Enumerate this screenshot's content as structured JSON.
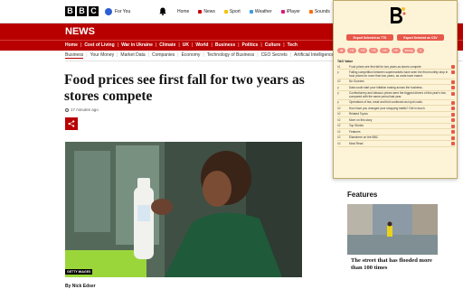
{
  "topbar": {
    "logo_letters": [
      "B",
      "B",
      "C"
    ],
    "signin_label": "For You",
    "nav": [
      {
        "label": "Home",
        "icon": ""
      },
      {
        "label": "News",
        "icon": "news-icon"
      },
      {
        "label": "Sport",
        "icon": "sport-icon"
      },
      {
        "label": "Weather",
        "icon": "weather-icon"
      },
      {
        "label": "iPlayer",
        "icon": "iplayer-icon"
      },
      {
        "label": "Sounds",
        "icon": "sounds-icon"
      }
    ]
  },
  "news_bar": {
    "title": "NEWS",
    "nav": [
      "Home",
      "Cost of Living",
      "War in Ukraine",
      "Climate",
      "UK",
      "World",
      "Business",
      "Politics",
      "Culture",
      "Tech"
    ]
  },
  "sub_nav": [
    "Business",
    "Your Money",
    "Market Data",
    "Companies",
    "Economy",
    "Technology of Business",
    "CEO Secrets",
    "Artificial Intelligence"
  ],
  "article": {
    "headline": "Food prices see first fall for two years as stores compete",
    "timestamp": "17 minutes ago",
    "photo_caption": "GETTY IMAGES",
    "byline": "By Nick Edser"
  },
  "features": {
    "title": "Features",
    "item_text": "The street that has flooded more than 100 times"
  },
  "popup": {
    "btn_selected": "Export Selected as TTS",
    "btn_csv": "Export Selected as CSV",
    "tags": [
      "all",
      "H1",
      "H2",
      "H3",
      "H4",
      "H5",
      "strong",
      "li"
    ],
    "list_head": "TAG   Value",
    "rows": [
      {
        "tag": "h1",
        "text": "Food prices see first fall for two years as stores compete"
      },
      {
        "tag": "p",
        "text": "Falling competition between supermarkets have seen the first monthly drop in food prices for more than two years, as costs have eased."
      },
      {
        "tag": "h2",
        "text": "No Sources"
      },
      {
        "tag": "p",
        "text": "Data could start your inflation easing across the business."
      },
      {
        "tag": "p",
        "text": "Confectionery and tobacco prices were the biggest drivers of this year's rise, compared with the same period last year."
      },
      {
        "tag": "p",
        "text": "Operations of tea, meat and fruit continued as input costs."
      },
      {
        "tag": "h2",
        "text": "How have you changed your shopping habits? Get in touch."
      },
      {
        "tag": "h2",
        "text": "Related Topics"
      },
      {
        "tag": "h2",
        "text": "More on this story"
      },
      {
        "tag": "h2",
        "text": "Top Stories"
      },
      {
        "tag": "h2",
        "text": "Features"
      },
      {
        "tag": "h2",
        "text": "Elsewhere on the BBC"
      },
      {
        "tag": "h2",
        "text": "Most Read"
      }
    ]
  },
  "colors": {
    "bbc_red": "#b80000",
    "popup_bg": "#fdf3d6",
    "popup_accent": "#e7584a"
  }
}
